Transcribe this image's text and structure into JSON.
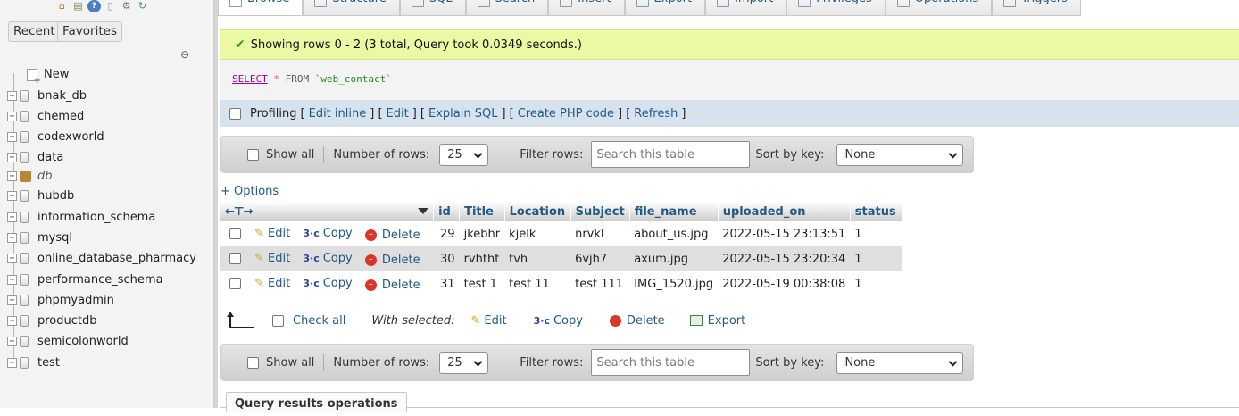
{
  "sidebar": {
    "top_icons": [
      "home-icon",
      "database-icon",
      "help-icon",
      "docs-icon",
      "settings-icon",
      "reload-icon"
    ],
    "recent_label": "Recent",
    "favorites_label": "Favorites",
    "new_label": "New",
    "databases": [
      "bnak_db",
      "chemed",
      "codexworld",
      "data",
      "db",
      "hubdb",
      "information_schema",
      "mysql",
      "online_database_pharmacy",
      "performance_schema",
      "phpmyadmin",
      "productdb",
      "semicolonworld",
      "test"
    ]
  },
  "tabs": [
    "Browse",
    "Structure",
    "SQL",
    "Search",
    "Insert",
    "Export",
    "Import",
    "Privileges",
    "Operations",
    "Triggers"
  ],
  "success_message": "Showing rows 0 - 2 (3 total, Query took 0.0349 seconds.)",
  "query": {
    "select": "SELECT",
    "star": "*",
    "from": "FROM",
    "table": "`web_contact`"
  },
  "profiling": {
    "label": "Profiling",
    "links": [
      "Edit inline",
      "Edit",
      "Explain SQL",
      "Create PHP code",
      "Refresh"
    ]
  },
  "nav": {
    "show_all": "Show all",
    "rows_label": "Number of rows:",
    "rows_value": "25",
    "filter_label": "Filter rows:",
    "filter_placeholder": "Search this table",
    "sort_label": "Sort by key:",
    "sort_value": "None"
  },
  "options_label": "+ Options",
  "table": {
    "columns": [
      "id",
      "Title",
      "Location",
      "Subject",
      "file_name",
      "uploaded_on",
      "status"
    ],
    "rows": [
      {
        "id": "29",
        "title": "jkebhr",
        "location": "kjelk",
        "subject": "nrvkl",
        "file_name": "about_us.jpg",
        "uploaded_on": "2022-05-15 23:13:51",
        "status": "1"
      },
      {
        "id": "30",
        "title": "rvhtht",
        "location": "tvh",
        "subject": "6vjh7",
        "file_name": "axum.jpg",
        "uploaded_on": "2022-05-15 23:20:34",
        "status": "1"
      },
      {
        "id": "31",
        "title": "test 1",
        "location": "test 11",
        "subject": "test 111",
        "file_name": "IMG_1520.jpg",
        "uploaded_on": "2022-05-19 00:38:08",
        "status": "1"
      }
    ],
    "row_actions": {
      "edit": "Edit",
      "copy": "Copy",
      "delete": "Delete"
    }
  },
  "with_selected": {
    "check_all": "Check all",
    "label": "With selected:",
    "edit": "Edit",
    "copy": "Copy",
    "delete": "Delete",
    "export": "Export"
  },
  "query_results_operations": "Query results operations"
}
